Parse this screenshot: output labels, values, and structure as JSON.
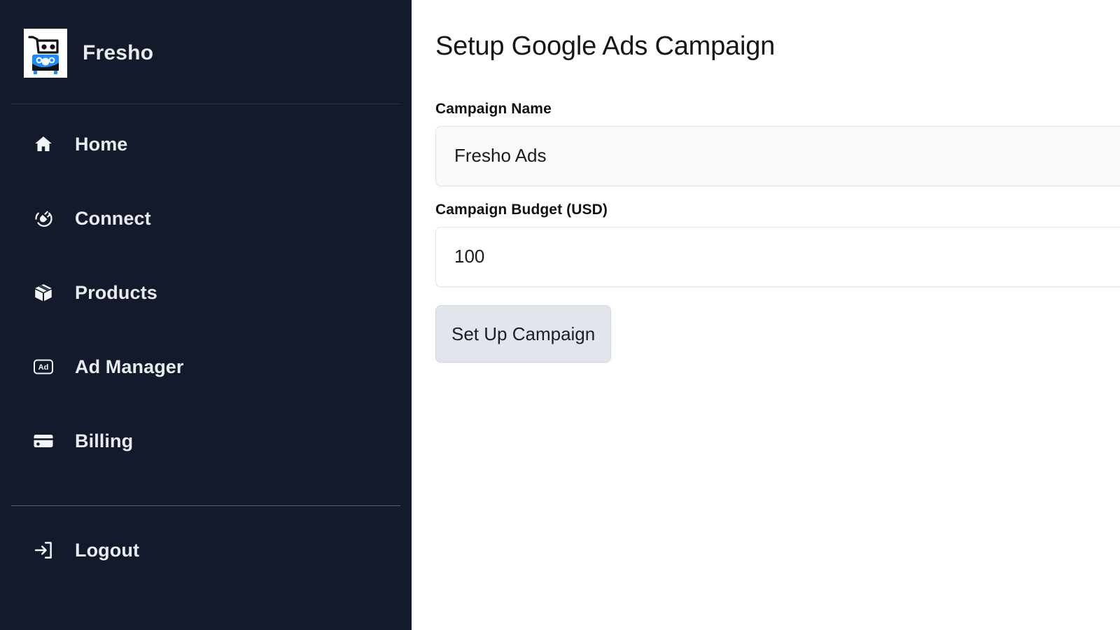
{
  "sidebar": {
    "brand": {
      "name": "Fresho",
      "logo_icon": "shopping-cart-basket-logo"
    },
    "items": [
      {
        "label": "Home",
        "icon": "home-icon"
      },
      {
        "label": "Connect",
        "icon": "plug-connect-icon"
      },
      {
        "label": "Products",
        "icon": "package-box-icon"
      },
      {
        "label": "Ad Manager",
        "icon": "ad-badge-icon"
      },
      {
        "label": "Billing",
        "icon": "credit-card-icon"
      }
    ],
    "bottom_items": [
      {
        "label": "Logout",
        "icon": "logout-arrow-icon"
      }
    ],
    "colors": {
      "background": "#131a2b",
      "text": "#e9ebef",
      "divider": "#2b3446",
      "divider_bright": "#5a6475"
    }
  },
  "main": {
    "title": "Setup Google Ads Campaign",
    "fields": [
      {
        "label": "Campaign Name",
        "value": "Fresho Ads",
        "placeholder": "Campaign Name"
      },
      {
        "label": "Campaign Budget (USD)",
        "value": "100",
        "placeholder": "Campaign Budget"
      }
    ],
    "submit_label": "Set Up Campaign",
    "colors": {
      "background": "#ffffff",
      "title": "#15161a",
      "button_background": "#e2e6ec",
      "input_tint": "#f9f9fa",
      "input_border": "#e3e6ea"
    }
  }
}
